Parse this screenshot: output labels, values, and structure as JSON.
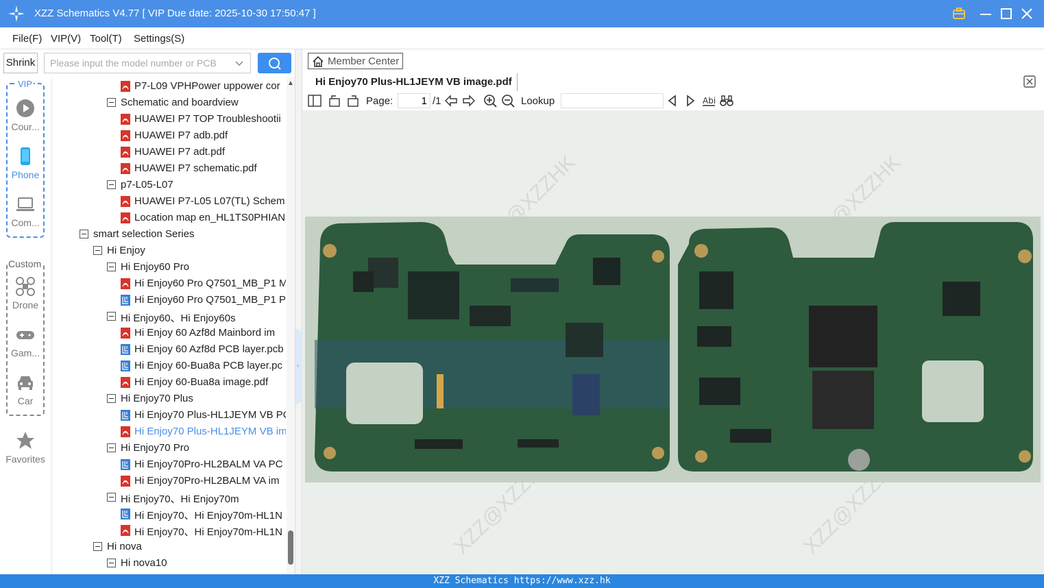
{
  "window": {
    "title": "XZZ Schematics V4.77 [ VIP Due date: 2025-10-30 17:50:47 ]"
  },
  "menu": [
    "File(F)",
    "VIP(V)",
    "Tool(T)",
    "Settings(S)"
  ],
  "search": {
    "shrink_label": "Shrink",
    "placeholder": "Please input the model number or PCB"
  },
  "nav": {
    "vip_label": "VIP",
    "custom_label": "Custom",
    "items": [
      {
        "label": "Cour...",
        "icon": "play-icon",
        "active": false
      },
      {
        "label": "Phone",
        "icon": "phone-icon",
        "active": true
      },
      {
        "label": "Com...",
        "icon": "laptop-icon",
        "active": false
      },
      {
        "label": "Drone",
        "icon": "drone-icon",
        "active": false
      },
      {
        "label": "Gam...",
        "icon": "gamepad-icon",
        "active": false
      },
      {
        "label": "Car",
        "icon": "car-icon",
        "active": false
      },
      {
        "label": "Favorites",
        "icon": "star-icon",
        "active": false
      }
    ]
  },
  "tree": [
    {
      "level": 3,
      "type": "pdf",
      "label": "P7-L09 VPHPower uppower cor"
    },
    {
      "level": 2,
      "type": "folder",
      "label": "Schematic and boardview"
    },
    {
      "level": 3,
      "type": "pdf",
      "label": "HUAWEI P7 TOP Troubleshootii"
    },
    {
      "level": 3,
      "type": "pdf",
      "label": "HUAWEI P7 adb.pdf"
    },
    {
      "level": 3,
      "type": "pdf",
      "label": "HUAWEI P7 adt.pdf"
    },
    {
      "level": 3,
      "type": "pdf",
      "label": "HUAWEI P7 schematic.pdf"
    },
    {
      "level": 2,
      "type": "folder",
      "label": "p7-L05-L07"
    },
    {
      "level": 3,
      "type": "pdf",
      "label": "HUAWEI P7-L05 L07(TL) Schem:"
    },
    {
      "level": 3,
      "type": "pdf",
      "label": "Location map en_HL1TS0PHIAN"
    },
    {
      "level": 0,
      "type": "folder",
      "label": "smart selection Series"
    },
    {
      "level": 1,
      "type": "folder",
      "label": "Hi Enjoy"
    },
    {
      "level": 2,
      "type": "folder",
      "label": "Hi Enjoy60 Pro"
    },
    {
      "level": 3,
      "type": "pdf",
      "label": "Hi Enjoy60 Pro Q7501_MB_P1 M"
    },
    {
      "level": 3,
      "type": "pcb",
      "label": "Hi Enjoy60 Pro Q7501_MB_P1 P"
    },
    {
      "level": 2,
      "type": "folder",
      "label": "Hi Enjoy60、Hi Enjoy60s"
    },
    {
      "level": 3,
      "type": "pdf",
      "label": "Hi Enjoy 60 Azf8d Mainbord im"
    },
    {
      "level": 3,
      "type": "pcb",
      "label": "Hi Enjoy 60 Azf8d PCB layer.pcb"
    },
    {
      "level": 3,
      "type": "pcb",
      "label": "Hi Enjoy 60-Bua8a PCB layer.pc"
    },
    {
      "level": 3,
      "type": "pdf",
      "label": "Hi Enjoy 60-Bua8a image.pdf"
    },
    {
      "level": 2,
      "type": "folder",
      "label": "Hi Enjoy70 Plus"
    },
    {
      "level": 3,
      "type": "pcb",
      "label": "Hi Enjoy70 Plus-HL1JEYM VB PC"
    },
    {
      "level": 3,
      "type": "pdf",
      "label": "Hi Enjoy70 Plus-HL1JEYM VB im",
      "selected": true
    },
    {
      "level": 2,
      "type": "folder",
      "label": "Hi Enjoy70 Pro"
    },
    {
      "level": 3,
      "type": "pcb",
      "label": "Hi Enjoy70Pro-HL2BALM VA PC"
    },
    {
      "level": 3,
      "type": "pdf",
      "label": "Hi Enjoy70Pro-HL2BALM VA im"
    },
    {
      "level": 2,
      "type": "folder",
      "label": "Hi Enjoy70、Hi Enjoy70m"
    },
    {
      "level": 3,
      "type": "pcb",
      "label": "Hi Enjoy70、Hi Enjoy70m-HL1N"
    },
    {
      "level": 3,
      "type": "pdf",
      "label": "Hi Enjoy70、Hi Enjoy70m-HL1N"
    },
    {
      "level": 1,
      "type": "folder",
      "label": "Hi nova"
    },
    {
      "level": 2,
      "type": "folder",
      "label": "Hi nova10"
    }
  ],
  "viewer": {
    "member_center": "Member Center",
    "doc_tab": "Hi Enjoy70 Plus-HL1JEYM VB image.pdf",
    "page_label": "Page:",
    "page_current": "1",
    "page_total": "/1",
    "lookup_label": "Lookup",
    "watermark": "XZZ@XZZHK"
  },
  "status": {
    "text": "XZZ Schematics https://www.xzz.hk"
  },
  "colors": {
    "titlebar": "#4a8fe7",
    "accent": "#3c8ef0",
    "pdf_icon": "#d9342b",
    "pcb_icon": "#3a7fd5",
    "statusbar": "#2b86df"
  }
}
